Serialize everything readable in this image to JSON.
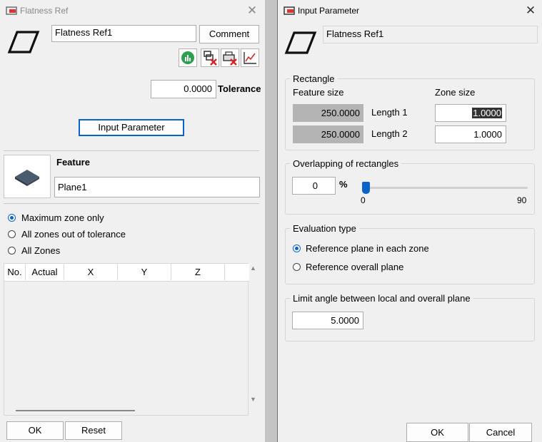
{
  "colors": {
    "window_bg": "#f0f0f0",
    "accent": "#0a63c9",
    "readonly_bg": "#b4b4b4"
  },
  "left": {
    "title": "Flatness Ref",
    "name_value": "Flatness Ref1",
    "comment_label": "Comment",
    "toolbar_icons": [
      "bar-chart-icon",
      "remove-element-icon",
      "print-remove-icon",
      "line-chart-icon"
    ],
    "tolerance_value": "0.0000",
    "tolerance_label": "Tolerance",
    "input_parameter_label": "Input Parameter",
    "feature_label": "Feature",
    "feature_value": "Plane1",
    "radios": [
      {
        "label": "Maximum zone only",
        "selected": true
      },
      {
        "label": "All zones out of tolerance",
        "selected": false
      },
      {
        "label": "All Zones",
        "selected": false
      }
    ],
    "table": {
      "columns": [
        "No.",
        "Actual",
        "X",
        "Y",
        "Z"
      ],
      "rows": []
    },
    "ok_label": "OK",
    "reset_label": "Reset"
  },
  "right": {
    "title": "Input Parameter",
    "name_value": "Flatness Ref1",
    "rectangle": {
      "title": "Rectangle",
      "feature_size_label": "Feature size",
      "zone_size_label": "Zone size",
      "length1_label": "Length 1",
      "length2_label": "Length 2",
      "feature_length1": "250.0000",
      "feature_length2": "250.0000",
      "zone_length1": "1.0000",
      "zone_length2": "1.0000"
    },
    "overlap": {
      "title": "Overlapping of rectangles",
      "value": "0",
      "unit": "%",
      "slider_min": "0",
      "slider_max": "90",
      "slider_value": 0
    },
    "evaluation": {
      "title": "Evaluation type",
      "options": [
        {
          "label": "Reference plane in each zone",
          "selected": true
        },
        {
          "label": "Reference overall plane",
          "selected": false
        }
      ]
    },
    "limit_angle": {
      "title": "Limit angle between local and overall plane",
      "value": "5.0000"
    },
    "ok_label": "OK",
    "cancel_label": "Cancel"
  }
}
